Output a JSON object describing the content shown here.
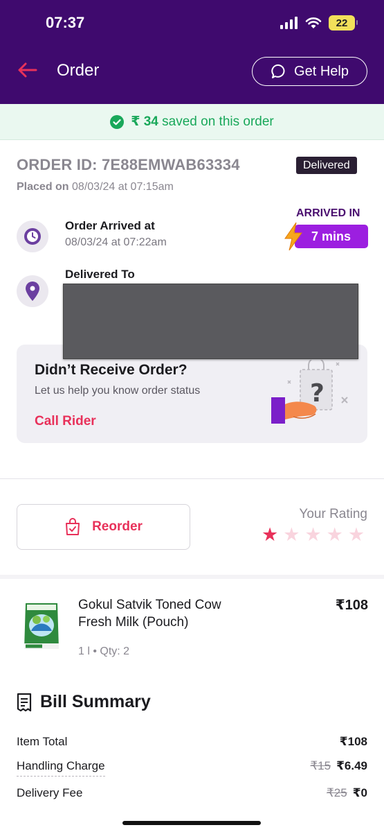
{
  "status_bar": {
    "time": "07:37",
    "battery": "22"
  },
  "header": {
    "title": "Order",
    "help_label": "Get Help"
  },
  "savings": {
    "amount": "₹ 34",
    "text": "saved on this order"
  },
  "order": {
    "id_label": "ORDER ID: 7E88EMWAB63334",
    "status": "Delivered",
    "placed_prefix": "Placed on",
    "placed_datetime": "08/03/24 at 07:15am",
    "arrived_title": "Order Arrived at",
    "arrived_datetime": "08/03/24 at 07:22am",
    "arrived_in_label": "ARRIVED IN",
    "arrived_in_value": "7 mins",
    "delivered_to_title": "Delivered To"
  },
  "help_card": {
    "title": "Didn’t Receive Order?",
    "subtitle": "Let us help you know order status",
    "action": "Call Rider"
  },
  "actions": {
    "reorder_label": "Reorder",
    "rating_label": "Your Rating",
    "rating_value": 1,
    "rating_max": 5
  },
  "product": {
    "name": "Gokul Satvik Toned Cow Fresh Milk (Pouch)",
    "meta": "1 l  •  Qty: 2",
    "price": "₹108"
  },
  "bill": {
    "title": "Bill Summary",
    "rows": [
      {
        "label": "Item Total",
        "original": "",
        "value": "₹108"
      },
      {
        "label": "Handling Charge",
        "original": "₹15",
        "value": "₹6.49"
      },
      {
        "label": "Delivery Fee",
        "original": "₹25",
        "value": "₹0"
      }
    ]
  },
  "colors": {
    "header_bg": "#3f0a6e",
    "accent_pink": "#e8315a",
    "savings_green": "#19a85a",
    "pill_purple": "#9c1fe0"
  }
}
